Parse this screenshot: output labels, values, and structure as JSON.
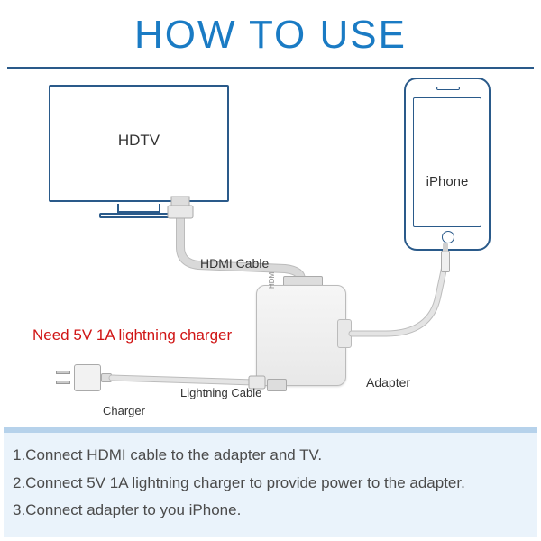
{
  "title": "HOW TO USE",
  "hdtv": {
    "label": "HDTV"
  },
  "iphone": {
    "label": "iPhone"
  },
  "cables": {
    "hdmi_label": "HDMI Cable",
    "lightning_label": "Lightning Cable",
    "charger_label": "Charger",
    "adapter_label": "Adapter",
    "adapter_port_label": "HDMI"
  },
  "warning": "Need 5V 1A lightning charger",
  "steps": {
    "1": "1.Connect HDMI cable to the adapter and TV.",
    "2": "2.Connect 5V 1A lightning charger to provide power to the adapter.",
    "3": "3.Connect adapter to you iPhone."
  }
}
